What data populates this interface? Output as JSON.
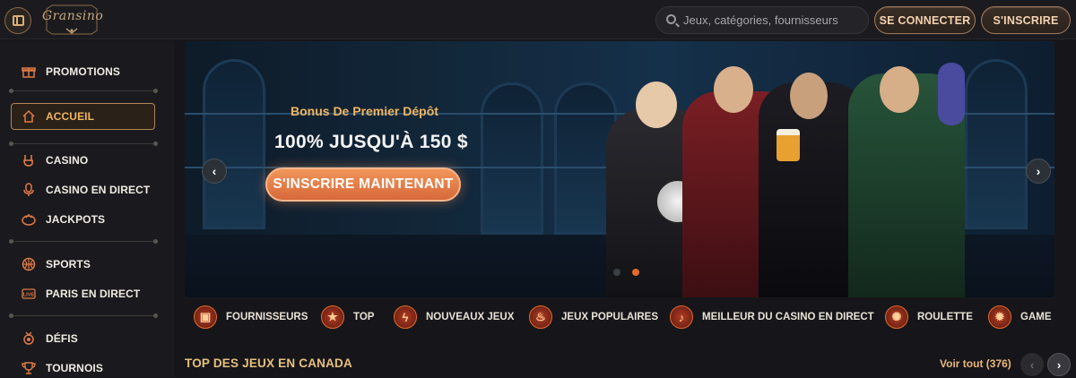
{
  "header": {
    "logo_text": "Gransino",
    "search_placeholder": "Jeux, catégories, fournisseurs",
    "login_label": "SE CONNECTER",
    "signup_label": "S'INSCRIRE"
  },
  "sidebar": {
    "items": [
      {
        "label": "PROMOTIONS",
        "icon": "gift-icon"
      },
      {
        "label": "ACCUEIL",
        "icon": "home-icon",
        "active": true
      },
      {
        "label": "CASINO",
        "icon": "rock-hand-icon"
      },
      {
        "label": "CASINO EN DIRECT",
        "icon": "microphone-icon"
      },
      {
        "label": "JACKPOTS",
        "icon": "jackpot-icon"
      },
      {
        "label": "SPORTS",
        "icon": "basketball-icon"
      },
      {
        "label": "PARIS EN DIRECT",
        "icon": "live-badge-icon"
      },
      {
        "label": "DÉFIS",
        "icon": "medal-icon"
      },
      {
        "label": "TOURNOIS",
        "icon": "trophy-icon"
      }
    ]
  },
  "banner": {
    "bonus_title": "Bonus De Premier Dépôt",
    "bonus_amount": "100% JUSQU'À 150 $",
    "cta_label": "S'INSCRIRE MAINTENANT",
    "slides_total": 2,
    "active_slide": 2
  },
  "categories": [
    {
      "label": "FOURNISSEURS",
      "icon": "slot-machine-icon"
    },
    {
      "label": "TOP",
      "icon": "star-icon"
    },
    {
      "label": "NOUVEAUX JEUX",
      "icon": "lightning-icon"
    },
    {
      "label": "JEUX POPULAIRES",
      "icon": "fire-icon"
    },
    {
      "label": "MEILLEUR DU CASINO EN DIRECT",
      "icon": "microphone-icon"
    },
    {
      "label": "ROULETTE",
      "icon": "roulette-icon"
    },
    {
      "label": "GAME",
      "icon": "wheel-icon"
    }
  ],
  "section": {
    "title": "TOP DES JEUX EN CANADA",
    "see_all": "Voir tout (376)"
  },
  "colors": {
    "accent": "#e26a2c",
    "gold": "#e8c07c",
    "background": "#16161a"
  }
}
